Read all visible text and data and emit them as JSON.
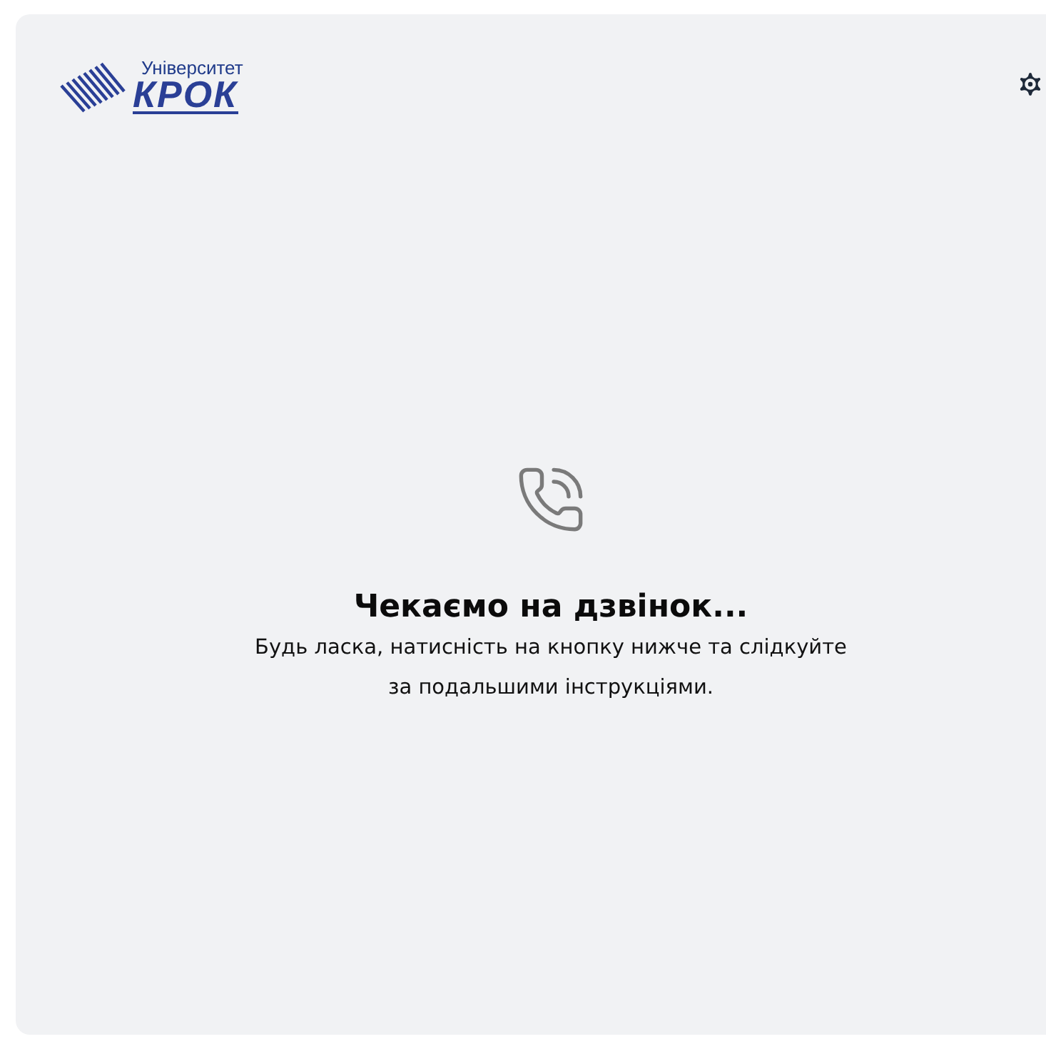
{
  "logo": {
    "caption": "Університет",
    "name": "КРОК"
  },
  "status": {
    "title": "Чекаємо на дзвінок...",
    "message_lines": [
      "Будь ласка, натисність на кнопку нижче та слідкуйте",
      "за подальшими інструкціями."
    ]
  }
}
